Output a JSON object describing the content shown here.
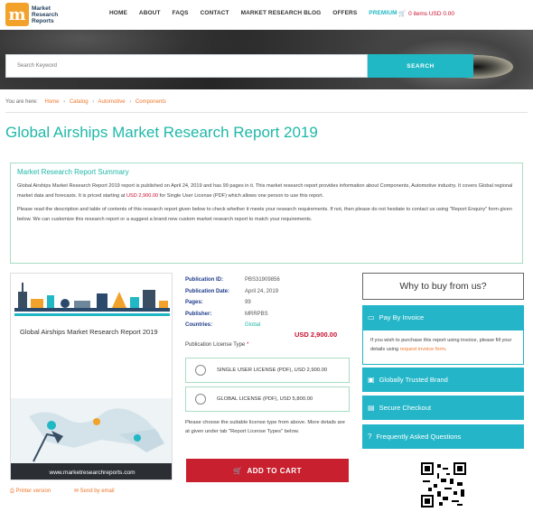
{
  "header": {
    "logo_text": [
      "Market",
      "Research",
      "Reports"
    ],
    "nav": [
      "HOME",
      "ABOUT",
      "FAQS",
      "CONTACT",
      "MARKET RESEARCH BLOG",
      "OFFERS",
      "PREMIUM"
    ],
    "cart": "0 items USD 0.00"
  },
  "search": {
    "placeholder": "Search Keyword",
    "button": "SEARCH"
  },
  "breadcrumb": {
    "prefix": "You are here:",
    "items": [
      "Home",
      "Catalog",
      "Automotive",
      "Components"
    ]
  },
  "page_title": "Global Airships Market Research Report 2019",
  "summary": {
    "heading": "Market Research Report Summary",
    "p1_before": "Global Airships Market Research Report 2019 report is published on April 24, 2019 and has 99 pages in it. This market research report provides information about Components, Automotive industry. It covers Global regional market data and forecasts. It is priced starting at ",
    "p1_price": "USD 2,900.00",
    "p1_after": " for Single User License (PDF) which allows one person to use this report.",
    "p2": "Please read the description and table of contents of this research report given below to check whether it meets your research requirements. If not, then please do not hesitate to contact us using \"Report Enquiry\" form given below. We can customize this research report or a suggest a brand new custom market research report to match your requirements."
  },
  "cover": {
    "title": "Global Airships Market Research Report 2019",
    "footer": "www.marketresearchreports.com"
  },
  "below_links": {
    "printer": "Printer version",
    "email": "Send by email"
  },
  "details": {
    "publication_id_label": "Publication ID:",
    "publication_id": "PBS31909856",
    "publication_date_label": "Publication Date:",
    "publication_date": "April 24, 2019",
    "pages_label": "Pages:",
    "pages": "99",
    "publisher_label": "Publisher:",
    "publisher": "MRRPBS",
    "countries_label": "Countries:",
    "countries": "Global"
  },
  "price": "USD 2,900.00",
  "license": {
    "type_label": "Publication License Type",
    "required_mark": "*",
    "single": "SINGLE USER LICENSE (PDF), USD 2,900.00",
    "global": "GLOBAL LICENSE (PDF), USD 5,800.00",
    "note": "Please choose the suitable license type from above. More details are at given under tab \"Report License Types\" below."
  },
  "add_to_cart": "ADD TO CART",
  "sidebar": {
    "why": "Why to buy from us?",
    "pay_by_invoice": "Pay By Invoice",
    "invoice_text_before": "If you wish to purchase this report using invoice, please fill your details using ",
    "invoice_link": "request invoice form",
    "invoice_text_after": ".",
    "globally_trusted": "Globally Trusted Brand",
    "secure_checkout": "Secure Checkout",
    "faq": "Frequently Asked Questions"
  },
  "colors": {
    "accent": "#1fb8c4",
    "title_green": "#1fb8a8",
    "link_orange": "#f0762a",
    "price_red": "#c8102e",
    "cart_button": "#c8202e"
  }
}
